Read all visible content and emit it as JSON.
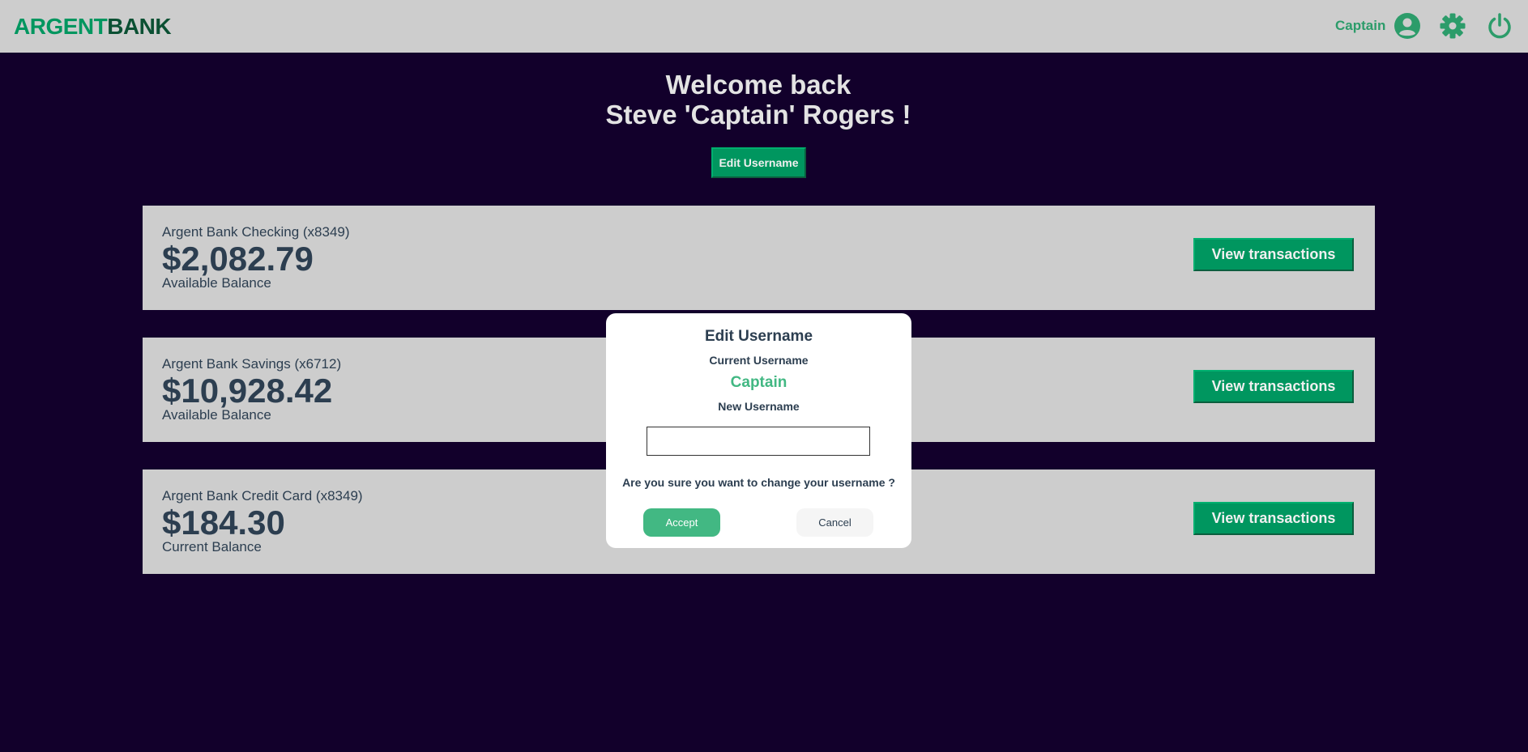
{
  "header": {
    "logo_part1": "ARGENT",
    "logo_part2": "BANK",
    "username": "Captain",
    "icons": [
      "user-circle-icon",
      "gear-icon",
      "power-icon"
    ]
  },
  "hero": {
    "line1": "Welcome back",
    "line2": "Steve 'Captain' Rogers !",
    "edit_button": "Edit Username"
  },
  "accounts": [
    {
      "title": "Argent Bank Checking (x8349)",
      "amount": "$2,082.79",
      "description": "Available Balance",
      "button": "View transactions"
    },
    {
      "title": "Argent Bank Savings (x6712)",
      "amount": "$10,928.42",
      "description": "Available Balance",
      "button": "View transactions"
    },
    {
      "title": "Argent Bank Credit Card (x8349)",
      "amount": "$184.30",
      "description": "Current Balance",
      "button": "View transactions"
    }
  ],
  "modal": {
    "title": "Edit Username",
    "current_label": "Current Username",
    "current_value": "Captain",
    "new_label": "New Username",
    "new_value": "",
    "confirm_text": "Are you sure you want to change your username ?",
    "accept": "Accept",
    "cancel": "Cancel"
  },
  "colors": {
    "background": "#12002b",
    "header": "#cdcdcd",
    "brand_green": "#00965f",
    "accent_green": "#42b883",
    "text_dark": "#2c3e50"
  }
}
